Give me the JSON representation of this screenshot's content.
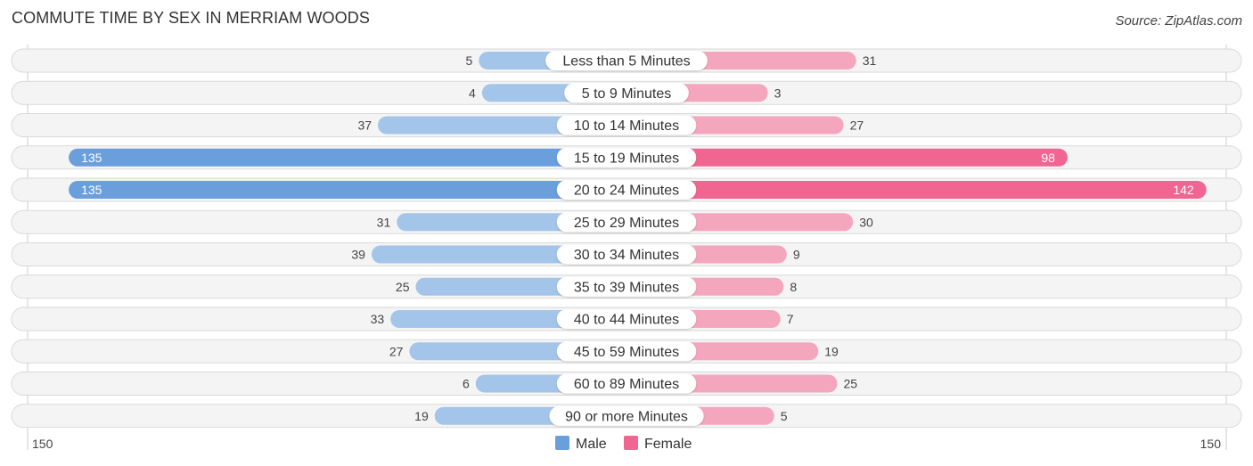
{
  "header": {
    "title": "COMMUTE TIME BY SEX IN MERRIAM WOODS",
    "source": "Source: ZipAtlas.com"
  },
  "colors": {
    "male": "#6a9fdc",
    "male_light": "#a4c5ea",
    "female": "#f06592",
    "female_light": "#f5a6bf",
    "row_bg": "#f4f4f4"
  },
  "chart_data": {
    "type": "bar",
    "orientation": "horizontal-diverging",
    "title": "COMMUTE TIME BY SEX IN MERRIAM WOODS",
    "categories": [
      "Less than 5 Minutes",
      "5 to 9 Minutes",
      "10 to 14 Minutes",
      "15 to 19 Minutes",
      "20 to 24 Minutes",
      "25 to 29 Minutes",
      "30 to 34 Minutes",
      "35 to 39 Minutes",
      "40 to 44 Minutes",
      "45 to 59 Minutes",
      "60 to 89 Minutes",
      "90 or more Minutes"
    ],
    "series": [
      {
        "name": "Male",
        "side": "left",
        "values": [
          5,
          4,
          37,
          135,
          135,
          31,
          39,
          25,
          33,
          27,
          6,
          19
        ]
      },
      {
        "name": "Female",
        "side": "right",
        "values": [
          31,
          3,
          27,
          98,
          142,
          30,
          9,
          8,
          7,
          19,
          25,
          5
        ]
      }
    ],
    "axis": {
      "left_max_label": "150",
      "right_max_label": "150",
      "range": [
        0,
        150
      ]
    },
    "legend": {
      "position": "bottom-center",
      "entries": [
        "Male",
        "Female"
      ]
    },
    "grid": false
  }
}
